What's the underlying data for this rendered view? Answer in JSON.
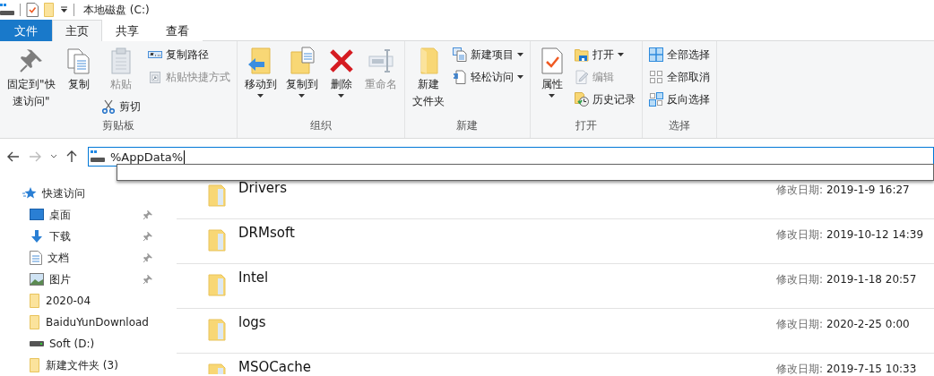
{
  "title_bar": {
    "title": "本地磁盘 (C:)"
  },
  "tabs": [
    {
      "label": "文件",
      "kind": "file",
      "selected": false
    },
    {
      "label": "主页",
      "kind": "tab",
      "selected": true
    },
    {
      "label": "共享",
      "kind": "tab",
      "selected": false
    },
    {
      "label": "查看",
      "kind": "tab",
      "selected": false
    }
  ],
  "ribbon": {
    "groups": [
      {
        "label": "剪贴板",
        "columns": [
          {
            "kind": "large",
            "items": [
              {
                "lines": [
                  "固定到\"快",
                  "速访问\""
                ],
                "disabled": false,
                "dropdown": false
              }
            ]
          },
          {
            "kind": "large",
            "items": [
              {
                "label": "复制",
                "disabled": false,
                "dropdown": false
              }
            ]
          },
          {
            "kind": "mixed",
            "items": [
              {
                "label": "粘贴",
                "disabled": true,
                "dropdown": false
              },
              {
                "label": "剪切",
                "disabled": false,
                "dropdown": false
              }
            ]
          },
          {
            "kind": "stack",
            "items": [
              {
                "label": "复制路径",
                "disabled": false,
                "dropdown": false
              },
              {
                "label": "粘贴快捷方式",
                "disabled": true,
                "dropdown": false
              }
            ]
          }
        ]
      },
      {
        "label": "组织",
        "columns": [
          {
            "kind": "large",
            "items": [
              {
                "label": "移动到",
                "disabled": false,
                "dropdown": true
              }
            ]
          },
          {
            "kind": "large",
            "items": [
              {
                "label": "复制到",
                "disabled": false,
                "dropdown": true
              }
            ]
          },
          {
            "kind": "large",
            "items": [
              {
                "label": "删除",
                "disabled": false,
                "dropdown": true
              }
            ]
          },
          {
            "kind": "large",
            "items": [
              {
                "label": "重命名",
                "disabled": true,
                "dropdown": false
              }
            ]
          }
        ]
      },
      {
        "label": "新建",
        "columns": [
          {
            "kind": "large",
            "items": [
              {
                "lines": [
                  "新建",
                  "文件夹"
                ],
                "disabled": false,
                "dropdown": false
              }
            ]
          },
          {
            "kind": "stack",
            "items": [
              {
                "label": "新建项目",
                "disabled": false,
                "dropdown": true
              },
              {
                "label": "轻松访问",
                "disabled": false,
                "dropdown": true
              }
            ]
          }
        ]
      },
      {
        "label": "打开",
        "columns": [
          {
            "kind": "large",
            "items": [
              {
                "label": "属性",
                "disabled": false,
                "dropdown": true
              }
            ]
          },
          {
            "kind": "stack",
            "items": [
              {
                "label": "打开",
                "disabled": false,
                "dropdown": true
              },
              {
                "label": "编辑",
                "disabled": true,
                "dropdown": false
              },
              {
                "label": "历史记录",
                "disabled": false,
                "dropdown": false
              }
            ]
          }
        ]
      },
      {
        "label": "选择",
        "columns": [
          {
            "kind": "stack",
            "items": [
              {
                "label": "全部选择",
                "disabled": false,
                "dropdown": false
              },
              {
                "label": "全部取消",
                "disabled": false,
                "dropdown": false
              },
              {
                "label": "反向选择",
                "disabled": false,
                "dropdown": false
              }
            ]
          }
        ]
      }
    ]
  },
  "address_bar": {
    "value": "%AppData%",
    "forward_disabled": true
  },
  "sidebar": {
    "items": [
      {
        "label": "快速访问",
        "kind": "star",
        "pinned": false
      },
      {
        "label": "桌面",
        "kind": "desktop",
        "pinned": true
      },
      {
        "label": "下载",
        "kind": "download",
        "pinned": true
      },
      {
        "label": "文档",
        "kind": "document",
        "pinned": true
      },
      {
        "label": "图片",
        "kind": "pictures",
        "pinned": true
      },
      {
        "label": "2020-04",
        "kind": "folder",
        "pinned": false
      },
      {
        "label": "BaiduYunDownload",
        "kind": "folder",
        "pinned": false
      },
      {
        "label": "Soft (D:)",
        "kind": "drive",
        "pinned": false
      },
      {
        "label": "新建文件夹 (3)",
        "kind": "folder",
        "pinned": false
      }
    ]
  },
  "files": [
    {
      "name": "Drivers",
      "date_label": "修改日期:",
      "date": "2019-1-9 16:27"
    },
    {
      "name": "DRMsoft",
      "date_label": "修改日期:",
      "date": "2019-10-12 14:39"
    },
    {
      "name": "Intel",
      "date_label": "修改日期:",
      "date": "2019-1-18 20:57"
    },
    {
      "name": "logs",
      "date_label": "修改日期:",
      "date": "2020-2-25 0:00"
    },
    {
      "name": "MSOCache",
      "date_label": "修改日期:",
      "date": "2019-7-15 10:33"
    }
  ]
}
